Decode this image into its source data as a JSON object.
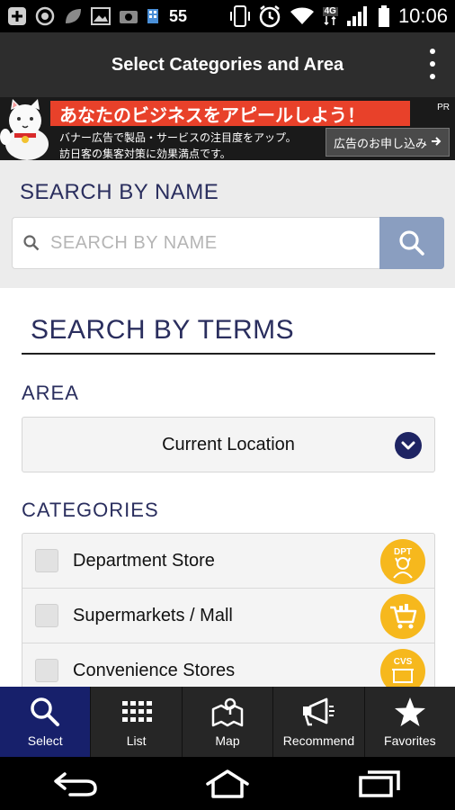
{
  "status_bar": {
    "notification_count": "55",
    "network_type": "4G",
    "time": "10:06"
  },
  "header": {
    "title": "Select Categories and Area"
  },
  "ad": {
    "headline": "あなたのビジネスをアピールしよう！",
    "line1": "バナー広告で製品・サービスの注目度をアップ。",
    "line2": "訪日客の集客対策に効果満点です。",
    "cta": "広告のお申し込み",
    "pr": "PR"
  },
  "search_by_name": {
    "heading": "SEARCH BY NAME",
    "placeholder": "SEARCH BY NAME"
  },
  "terms": {
    "heading": "SEARCH BY TERMS",
    "area_label": "AREA",
    "area_value": "Current Location",
    "categories_label": "CATEGORIES",
    "categories": [
      {
        "name": "Department Store",
        "badge": "DPT",
        "icon": "department-store-icon"
      },
      {
        "name": "Supermarkets / Mall",
        "badge": "",
        "icon": "shopping-cart-icon"
      },
      {
        "name": "Convenience Stores",
        "badge": "CVS",
        "icon": "convenience-store-icon"
      }
    ]
  },
  "tabs": [
    {
      "label": "Select",
      "icon": "search-icon",
      "active": true
    },
    {
      "label": "List",
      "icon": "list-icon",
      "active": false
    },
    {
      "label": "Map",
      "icon": "map-icon",
      "active": false
    },
    {
      "label": "Recommend",
      "icon": "megaphone-icon",
      "active": false
    },
    {
      "label": "Favorites",
      "icon": "star-icon",
      "active": false
    }
  ],
  "colors": {
    "navy": "#2a2e5e",
    "active_tab": "#17206b",
    "search_button": "#8a9ec0",
    "badge": "#f6b81d",
    "ad_red": "#e8412a"
  }
}
